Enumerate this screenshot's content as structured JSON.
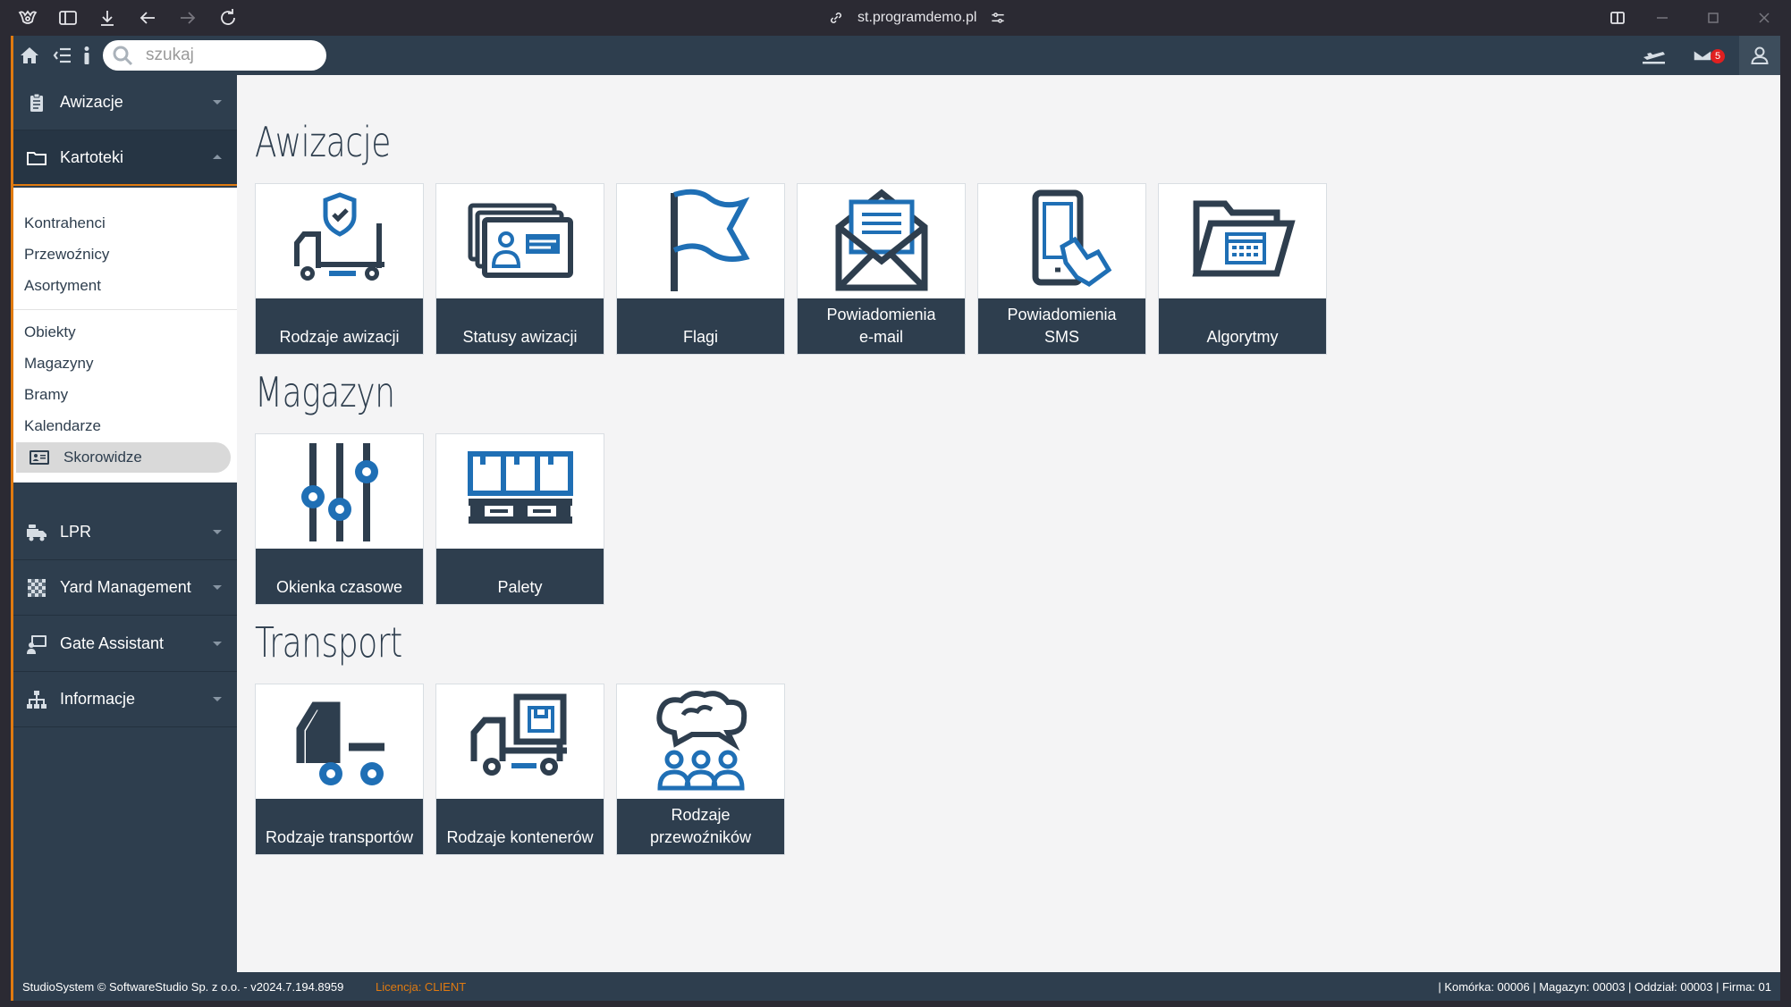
{
  "browser": {
    "url": "st.programdemo.pl"
  },
  "search": {
    "placeholder": "szukaj"
  },
  "topbar": {
    "mail_count": "5"
  },
  "sidebar": {
    "sections": [
      {
        "label": "Awizacje"
      },
      {
        "label": "Kartoteki"
      },
      {
        "label": "LPR"
      },
      {
        "label": "Yard Management"
      },
      {
        "label": "Gate Assistant"
      },
      {
        "label": "Informacje"
      }
    ],
    "kartoteki_items": [
      {
        "label": "Kontrahenci"
      },
      {
        "label": "Przewoźnicy"
      },
      {
        "label": "Asortyment"
      },
      {
        "label": "Obiekty"
      },
      {
        "label": "Magazyny"
      },
      {
        "label": "Bramy"
      },
      {
        "label": "Kalendarze"
      },
      {
        "label": "Skorowidze"
      }
    ]
  },
  "main": {
    "sections": [
      {
        "title": "Awizacje",
        "tiles": [
          {
            "label": "Rodzaje awizacji",
            "icon": "truck-shield-icon"
          },
          {
            "label": "Statusy awizacji",
            "icon": "id-cards-icon"
          },
          {
            "label": "Flagi",
            "icon": "flag-icon"
          },
          {
            "label": "Powiadomienia\ne-mail",
            "icon": "envelope-icon"
          },
          {
            "label": "Powiadomienia\nSMS",
            "icon": "phone-touch-icon"
          },
          {
            "label": "Algorytmy",
            "icon": "folder-calendar-icon"
          }
        ]
      },
      {
        "title": "Magazyn",
        "tiles": [
          {
            "label": "Okienka czasowe",
            "icon": "sliders-icon"
          },
          {
            "label": "Palety",
            "icon": "pallet-icon"
          }
        ]
      },
      {
        "title": "Transport",
        "tiles": [
          {
            "label": "Rodzaje transportów",
            "icon": "truck-icon"
          },
          {
            "label": "Rodzaje kontenerów",
            "icon": "container-truck-icon"
          },
          {
            "label": "Rodzaje\nprzewoźników",
            "icon": "people-chat-icon"
          }
        ]
      }
    ]
  },
  "footer": {
    "copyright": "StudioSystem © SoftwareStudio Sp. z o.o. - v2024.7.194.8959",
    "license": "Licencja: CLIENT",
    "context": "| Komórka: 00006 | Magazyn: 00003 | Oddział: 00003 | Firma: 01"
  },
  "colors": {
    "dark": "#2e3e4e",
    "accent": "#e07a10",
    "icon_blue": "#1f6fb5"
  }
}
